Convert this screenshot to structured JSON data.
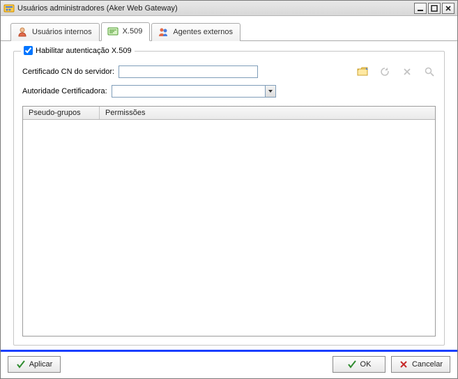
{
  "window": {
    "title": "Usuários administradores (Aker Web Gateway)"
  },
  "tabs": {
    "internal": "Usuários internos",
    "x509": "X.509",
    "agents": "Agentes externos"
  },
  "x509": {
    "enable_label": "Habilitar autenticação X.509",
    "enable_checked": true,
    "server_cn_label": "Certificado CN do servidor:",
    "server_cn_value": "",
    "ca_label": "Autoridade Certificadora:",
    "ca_value": ""
  },
  "grid": {
    "columns": [
      "Pseudo-grupos",
      "Permissões"
    ],
    "rows": []
  },
  "buttons": {
    "apply": "Aplicar",
    "ok": "OK",
    "cancel": "Cancelar"
  }
}
